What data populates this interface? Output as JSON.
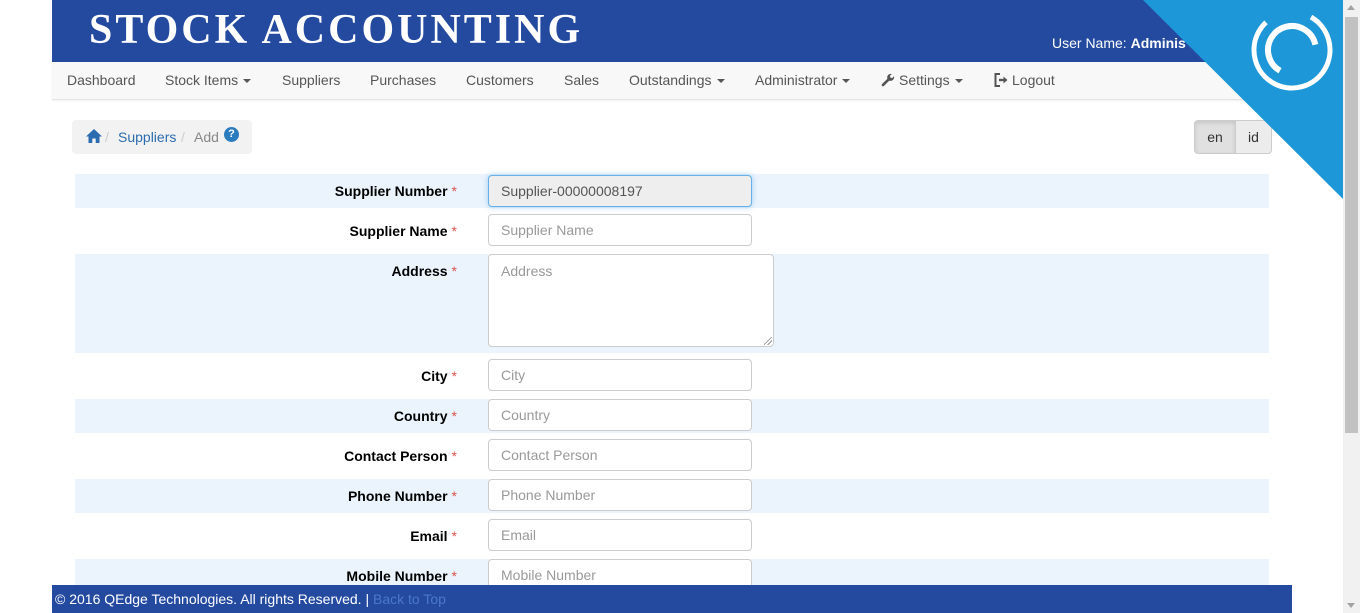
{
  "header": {
    "brand": "STOCK ACCOUNTING",
    "user_label": "User Name: ",
    "user_value": "Adminis"
  },
  "nav": {
    "items": [
      {
        "label": "Dashboard"
      },
      {
        "label": "Stock Items"
      },
      {
        "label": "Suppliers"
      },
      {
        "label": "Purchases"
      },
      {
        "label": "Customers"
      },
      {
        "label": "Sales"
      },
      {
        "label": "Outstandings"
      },
      {
        "label": "Administrator"
      },
      {
        "label": "Settings"
      },
      {
        "label": "Logout"
      }
    ]
  },
  "breadcrumb": {
    "sep": "/",
    "suppliers": "Suppliers",
    "add": "Add",
    "help": "?"
  },
  "lang": {
    "en": "en",
    "id": "id"
  },
  "form": {
    "required_mark": "*",
    "fields": [
      {
        "label": "Supplier Number",
        "value": "Supplier-00000008197"
      },
      {
        "label": "Supplier Name",
        "placeholder": "Supplier Name"
      },
      {
        "label": "Address",
        "placeholder": "Address"
      },
      {
        "label": "City",
        "placeholder": "City"
      },
      {
        "label": "Country",
        "placeholder": "Country"
      },
      {
        "label": "Contact Person",
        "placeholder": "Contact Person"
      },
      {
        "label": "Phone Number",
        "placeholder": "Phone Number"
      },
      {
        "label": "Email",
        "placeholder": "Email"
      },
      {
        "label": "Mobile Number",
        "placeholder": "Mobile Number"
      }
    ]
  },
  "footer": {
    "copyright": "© 2016 QEdge Technologies. All rights Reserved. | ",
    "back_to_top": "Back to Top"
  },
  "colors": {
    "header_blue": "#244aa0",
    "stripe": "#ebf4fd",
    "corner_blue": "#1e97d8",
    "link": "#2b6cb0"
  }
}
